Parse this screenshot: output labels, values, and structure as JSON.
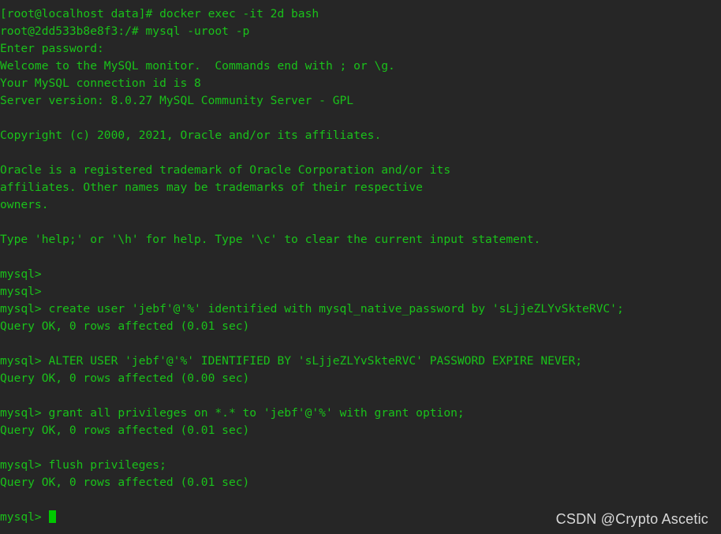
{
  "terminal": {
    "background_color": "#262626",
    "text_color": "#1ac21a",
    "cursor_color": "#00c800",
    "lines": [
      "[root@localhost data]# docker exec -it 2d bash",
      "root@2dd533b8e8f3:/# mysql -uroot -p",
      "Enter password:",
      "Welcome to the MySQL monitor.  Commands end with ; or \\g.",
      "Your MySQL connection id is 8",
      "Server version: 8.0.27 MySQL Community Server - GPL",
      "",
      "Copyright (c) 2000, 2021, Oracle and/or its affiliates.",
      "",
      "Oracle is a registered trademark of Oracle Corporation and/or its",
      "affiliates. Other names may be trademarks of their respective",
      "owners.",
      "",
      "Type 'help;' or '\\h' for help. Type '\\c' to clear the current input statement.",
      "",
      "mysql>",
      "mysql>",
      "mysql> create user 'jebf'@'%' identified with mysql_native_password by 'sLjjeZLYvSkteRVC';",
      "Query OK, 0 rows affected (0.01 sec)",
      "",
      "mysql> ALTER USER 'jebf'@'%' IDENTIFIED BY 'sLjjeZLYvSkteRVC' PASSWORD EXPIRE NEVER;",
      "Query OK, 0 rows affected (0.00 sec)",
      "",
      "mysql> grant all privileges on *.* to 'jebf'@'%' with grant option;",
      "Query OK, 0 rows affected (0.01 sec)",
      "",
      "mysql> flush privileges;",
      "Query OK, 0 rows affected (0.01 sec)",
      ""
    ],
    "prompt": "mysql> "
  },
  "watermark": {
    "text": "CSDN @Crypto Ascetic"
  }
}
